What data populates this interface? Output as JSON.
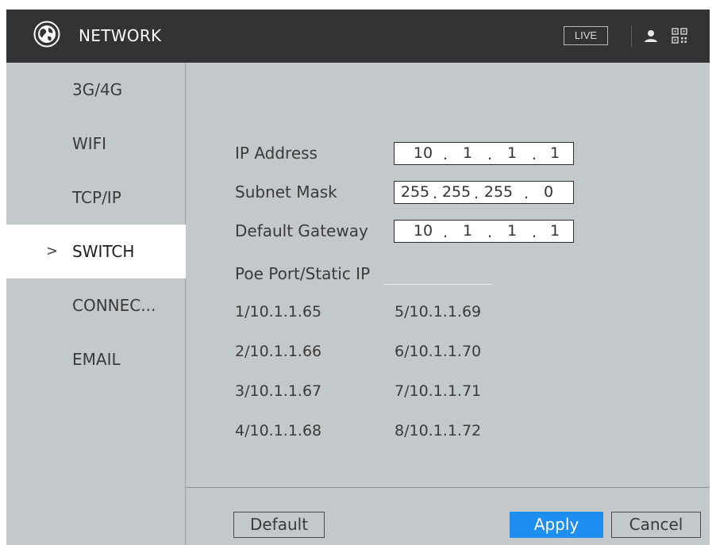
{
  "header": {
    "title": "NETWORK",
    "live_label": "LIVE",
    "logo_icon": "globe-logo-icon",
    "user_icon": "user-icon",
    "qr_icon": "qr-code-icon"
  },
  "sidebar": {
    "items": [
      {
        "label": "3G/4G",
        "active": false
      },
      {
        "label": "WIFI",
        "active": false
      },
      {
        "label": "TCP/IP",
        "active": false
      },
      {
        "label": "SWITCH",
        "active": true
      },
      {
        "label": "CONNEC...",
        "active": false
      },
      {
        "label": "EMAIL",
        "active": false
      }
    ],
    "active_marker": ">"
  },
  "form": {
    "ip_address": {
      "label": "IP Address",
      "octets": [
        "10",
        "1",
        "1",
        "1"
      ]
    },
    "subnet_mask": {
      "label": "Subnet Mask",
      "octets": [
        "255",
        "255",
        "255",
        "0"
      ]
    },
    "default_gateway": {
      "label": "Default Gateway",
      "octets": [
        "10",
        "1",
        "1",
        "1"
      ]
    },
    "octet_separator": "."
  },
  "poe": {
    "title": "Poe Port/Static IP",
    "ports": [
      "1/10.1.1.65",
      "2/10.1.1.66",
      "3/10.1.1.67",
      "4/10.1.1.68",
      "5/10.1.1.69",
      "6/10.1.1.70",
      "7/10.1.1.71",
      "8/10.1.1.72"
    ]
  },
  "buttons": {
    "default": "Default",
    "apply": "Apply",
    "cancel": "Cancel"
  },
  "colors": {
    "header_bg": "#313335",
    "panel_bg": "#c3c9ca",
    "accent": "#1e8ff0"
  }
}
